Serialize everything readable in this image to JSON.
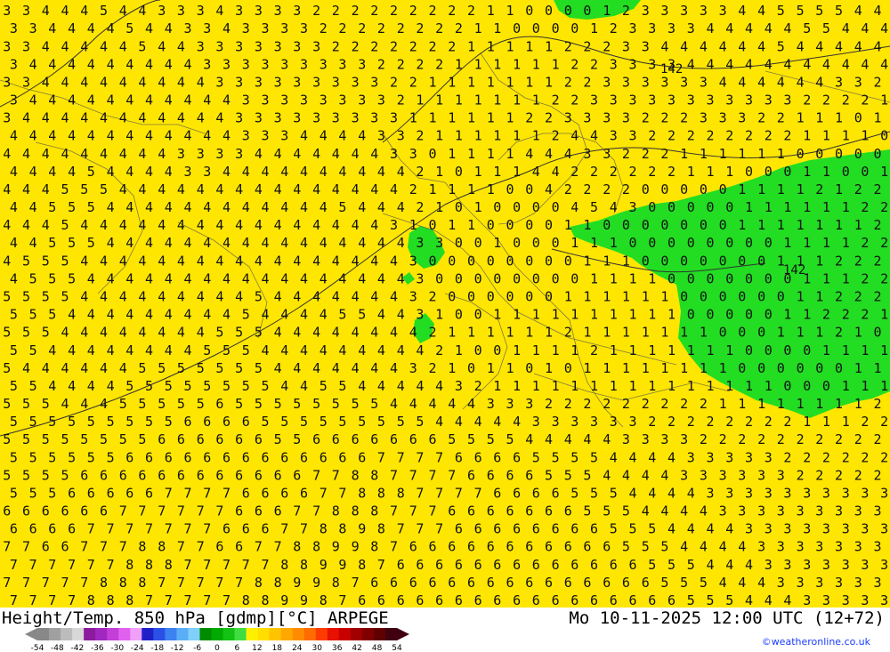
{
  "header": {
    "title": "Height/Temp. 850 hPa [gdmp][°C] ARPEGE",
    "valid_time": "Mo 10-11-2025 12:00 UTC (12+72)"
  },
  "credit": "©weatheronline.co.uk",
  "legend": {
    "tick_labels": [
      "-54",
      "-48",
      "-42",
      "-36",
      "-30",
      "-24",
      "-18",
      "-12",
      "-6",
      "0",
      "6",
      "12",
      "18",
      "24",
      "30",
      "36",
      "42",
      "48",
      "54"
    ],
    "colors": [
      "#888888",
      "#a0a0a0",
      "#bcbcbc",
      "#d8d8d8",
      "#8c1a9e",
      "#a028c0",
      "#c43ed8",
      "#e060f0",
      "#f0a0f8",
      "#2020c8",
      "#2a50e6",
      "#3c82f0",
      "#5aaef6",
      "#80d0fa",
      "#008c00",
      "#00aa00",
      "#14c214",
      "#40dc40",
      "#fff000",
      "#ffde00",
      "#ffc400",
      "#ffa800",
      "#ff8c00",
      "#ff6c00",
      "#ff3c00",
      "#e81000",
      "#c80000",
      "#a00000",
      "#800000",
      "#600000",
      "#400010"
    ]
  },
  "map": {
    "colors": {
      "warm": "#ffe600",
      "cold": "#22dd22",
      "text": "#111111",
      "border": "#555555"
    },
    "contour_labels": [
      "142",
      "142"
    ],
    "grid_rows": [
      "3 3 4 4 4 5 4 4 3 3 3 4 3 3 3 3 2 2 2 2 2 2 2 2 2 1 1 0 0 0 0 1 2 3 3 3 3 3 4 4 5 5 5 5 4 4",
      "3 3 4 4 4 4 5 4 4 3 3 4 3 3 3 3 2 2 2 2 2 2 2 2 1 1 0 0 0 0 1 2 3 3 3 3 4 4 4 4 4 5 5 4 4 4",
      "3 3 4 4 4 4 4 5 4 4 3 3 3 3 3 3 3 2 2 2 2 2 2 2 1 1 1 1 1 2 2 2 3 3 4 4 4 4 4 4 5 4 4 4 4 4",
      "3 4 4 4 4 4 4 4 4 4 3 3 3 3 3 3 3 3 3 2 2 2 2 1 1 1 1 1 1 2 2 3 3 3 3 4 4 4 4 4 4 4 4 4 4 4",
      "3 3 4 4 4 4 4 4 4 4 4 3 3 3 3 3 3 3 3 3 2 2 1 1 1 1 1 1 1 2 2 3 3 3 3 3 3 4 4 4 4 4 4 3 3 2",
      "3 4 4 4 4 4 4 4 4 4 4 4 3 3 3 3 3 3 3 3 2 1 1 1 1 1 1 1 2 2 3 3 3 3 3 3 3 3 3 3 3 2 2 2 2 1",
      "3 4 4 4 4 4 4 4 4 4 4 4 3 3 3 3 3 3 3 3 3 1 1 1 1 1 1 2 2 3 3 3 3 2 2 2 3 3 3 2 2 1 1 1 0 1",
      "4 4 4 4 4 4 4 4 4 4 4 4 3 3 3 4 4 4 4 3 3 2 1 1 1 1 1 1 2 4 4 3 3 2 2 2 2 2 2 2 2 1 1 1 1 0",
      "4 4 4 4 4 4 4 4 4 3 3 3 3 4 4 4 4 4 4 4 3 3 0 1 1 1 1 4 4 4 3 3 2 2 2 1 1 1 1 1 1 0 0 0 0 0",
      "4 4 4 4 5 4 4 4 4 3 3 4 4 4 4 4 4 4 4 4 4 2 1 0 1 1 1 4 4 2 2 2 2 2 2 1 1 1 0 0 0 1 1 0 0 1",
      "4 4 4 5 5 5 4 4 4 4 4 4 4 4 4 4 4 4 4 4 4 2 1 1 1 1 0 0 4 2 2 2 2 0 0 0 0 0 1 1 1 1 2 1 2 2",
      "4 4 5 5 5 4 4 4 4 4 4 4 4 4 4 4 4 5 4 4 4 2 1 0 1 0 0 0 0 4 5 4 3 0 0 0 0 0 1 1 1 1 1 1 2 2",
      "4 4 4 5 4 4 4 4 4 4 4 4 4 4 4 4 4 4 4 4 3 1 0 1 1 0 0 0 0 1 1 0 0 0 0 0 0 0 1 1 1 1 1 1 1 2",
      "4 4 5 5 5 4 4 4 4 4 4 4 4 4 4 4 4 4 4 4 4 3 3 0 0 1 0 0 0 1 1 1 0 0 0 0 0 0 0 0 1 1 1 1 2 2",
      "4 5 5 5 4 4 4 4 4 4 4 4 4 4 4 4 4 4 4 4 4 3 0 0 0 0 0 0 0 0 1 1 1 0 0 0 0 0 0 0 1 1 1 2 2 2",
      "4 5 5 5 4 4 4 4 4 4 4 4 4 4 4 4 4 4 4 4 4 3 0 0 0 0 0 0 0 0 1 1 1 1 0 0 0 0 0 0 0 1 1 1 2 2",
      "5 5 5 5 4 4 4 4 4 4 4 4 4 5 4 4 4 4 4 4 4 3 2 0 0 0 0 0 0 1 1 1 1 1 1 0 0 0 0 0 0 1 1 2 2 2",
      "5 5 5 4 4 4 4 4 4 4 4 4 5 4 4 4 4 5 5 4 4 3 1 0 0 1 1 1 1 1 1 1 1 1 1 0 0 0 0 0 1 1 2 2 2 1",
      "5 5 5 4 4 4 4 4 4 4 4 5 5 5 4 4 4 4 4 4 4 4 2 1 1 1 1 1 1 2 1 1 1 1 1 1 1 0 0 0 1 1 1 2 1 0",
      "5 5 4 4 4 4 4 4 4 4 5 5 5 4 4 4 4 4 4 4 4 4 2 1 0 0 1 1 1 1 2 1 1 1 1 1 1 1 0 0 0 0 1 1 1 1",
      "5 4 4 4 4 4 4 5 5 5 5 5 5 5 4 4 4 4 4 4 4 3 2 1 0 1 1 0 1 0 1 1 1 1 1 1 1 1 0 0 0 0 0 0 1 1",
      "5 5 4 4 4 4 5 5 5 5 5 5 5 5 4 4 5 5 4 4 4 4 4 3 2 1 1 1 1 1 1 1 1 1 1 1 1 1 1 1 0 0 0 1 1 1",
      "5 5 5 4 4 4 5 5 5 5 5 6 5 5 5 5 5 5 5 5 4 4 4 4 4 3 3 3 2 2 2 2 2 2 2 2 2 1 1 1 1 1 1 1 1 2",
      "5 5 5 5 5 5 5 5 5 6 6 6 6 5 5 5 5 5 5 5 5 5 4 4 4 4 4 3 3 3 3 3 3 2 2 2 2 2 2 2 2 1 1 1 2 2",
      "5 5 5 5 5 5 5 5 6 6 6 6 6 6 5 5 6 6 6 6 6 6 6 5 5 5 5 4 4 4 4 4 3 3 3 3 2 2 2 2 2 2 2 2 2 2",
      "5 5 5 5 5 5 6 6 6 6 6 6 6 6 6 6 6 6 6 7 7 7 7 6 6 6 6 5 5 5 5 4 4 4 4 3 3 3 3 3 2 2 2 2 2 2",
      "5 5 5 5 6 6 6 6 6 6 6 6 6 6 6 6 7 7 8 8 7 7 7 7 6 6 6 6 5 5 5 4 4 4 4 3 3 3 3 3 3 2 2 2 2 2",
      "5 5 5 6 6 6 6 6 7 7 7 7 6 6 6 6 7 7 8 8 8 7 7 7 7 6 6 6 6 5 5 5 4 4 4 4 3 3 3 3 3 3 3 3 3 3",
      "6 6 6 6 6 6 7 7 7 7 7 7 6 6 6 7 7 8 8 8 7 7 7 6 6 6 6 6 6 6 5 5 5 4 4 4 4 3 3 3 3 3 3 3 3 3",
      "6 6 6 6 7 7 7 7 7 7 7 6 6 6 7 7 8 8 9 8 7 7 7 6 6 6 6 6 6 6 6 5 5 5 4 4 4 4 3 3 3 3 3 3 3 3",
      "7 7 6 6 7 7 7 8 8 7 7 6 6 7 7 8 8 9 9 8 7 6 6 6 6 6 6 6 6 6 6 6 5 5 5 4 4 4 4 3 3 3 3 3 3 3",
      "7 7 7 7 7 7 8 8 8 7 7 7 7 7 8 8 9 9 8 7 6 6 6 6 6 6 6 6 6 6 6 6 6 5 5 5 4 4 4 3 3 3 3 3 3 3",
      "7 7 7 7 7 8 8 8 7 7 7 7 7 8 8 9 9 8 7 6 6 6 6 6 6 6 6 6 6 6 6 6 6 6 5 5 5 4 4 4 3 3 3 3 3 3",
      "7 7 7 7 8 8 8 7 7 7 7 7 8 8 9 9 8 7 6 6 6 6 6 6 6 6 6 6 6 6 6 6 6 6 6 5 5 5 4 4 4 3 3 3 3 3"
    ]
  }
}
